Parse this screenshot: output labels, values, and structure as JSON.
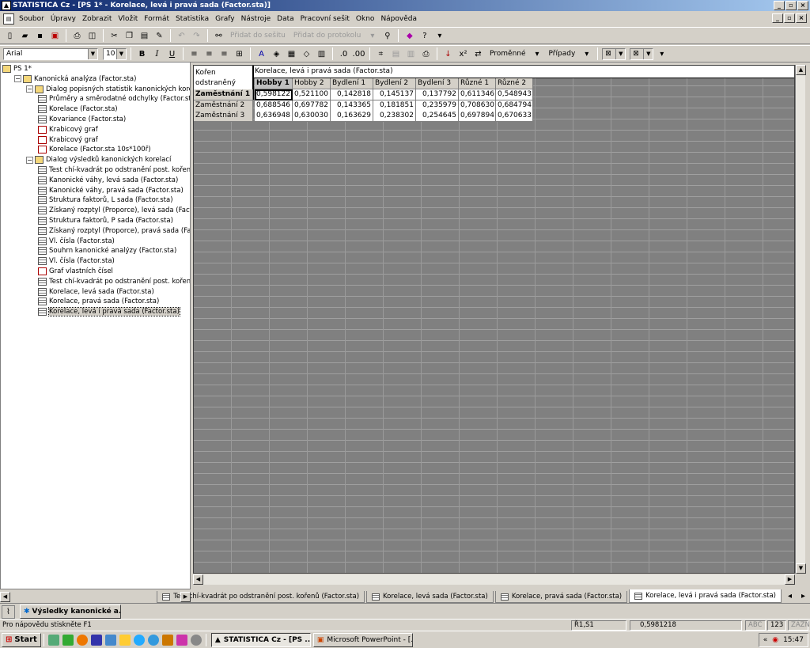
{
  "window": {
    "title": "STATISTICA Cz - [PS 1* - Korelace, levá i pravá sada (Factor.sta)]",
    "app_icon": "statistica-icon"
  },
  "menu": [
    "Soubor",
    "Úpravy",
    "Zobrazit",
    "Vložit",
    "Formát",
    "Statistika",
    "Grafy",
    "Nástroje",
    "Data",
    "Pracovní sešit",
    "Okno",
    "Nápověda"
  ],
  "toolbar1": {
    "add_to_workbook": "Přidat do sešitu",
    "add_to_report": "Přidat do protokolu"
  },
  "toolbar2": {
    "font_name": "Arial",
    "font_size": "10",
    "bold": "B",
    "italic": "I",
    "underline": "U",
    "variables": "Proměnné",
    "cases": "Případy"
  },
  "tree": [
    {
      "label": "PS 1*",
      "level": 0,
      "icon": "folder"
    },
    {
      "label": "Kanonická analýza (Factor.sta)",
      "level": 1,
      "icon": "folder",
      "exp": true
    },
    {
      "label": "Dialog popisných statistik kanonických korelací",
      "level": 2,
      "icon": "folder",
      "exp": true
    },
    {
      "label": "Průměry a směrodatné odchylky (Factor.sta)",
      "level": 3,
      "icon": "table"
    },
    {
      "label": "Korelace (Factor.sta)",
      "level": 3,
      "icon": "table"
    },
    {
      "label": "Kovariance (Factor.sta)",
      "level": 3,
      "icon": "table"
    },
    {
      "label": "Krabicový graf",
      "level": 3,
      "icon": "graph"
    },
    {
      "label": "Krabicový graf",
      "level": 3,
      "icon": "graph"
    },
    {
      "label": "Korelace (Factor.sta 10s*100ř)",
      "level": 3,
      "icon": "graph"
    },
    {
      "label": "Dialog výsledků kanonických korelací",
      "level": 2,
      "icon": "folder",
      "exp": true
    },
    {
      "label": "Test chí-kvadrát po odstranění post. kořenů (F",
      "level": 3,
      "icon": "table"
    },
    {
      "label": "Kanonické váhy, levá sada (Factor.sta)",
      "level": 3,
      "icon": "table"
    },
    {
      "label": "Kanonické váhy, pravá sada (Factor.sta)",
      "level": 3,
      "icon": "table"
    },
    {
      "label": "Struktura faktorů, L sada (Factor.sta)",
      "level": 3,
      "icon": "table"
    },
    {
      "label": "Získaný rozptyl (Proporce), levá sada (Factor.",
      "level": 3,
      "icon": "table"
    },
    {
      "label": "Struktura faktorů, P sada (Factor.sta)",
      "level": 3,
      "icon": "table"
    },
    {
      "label": "Získaný rozptyl (Proporce), pravá sada (Facto",
      "level": 3,
      "icon": "table"
    },
    {
      "label": "Vl. čísla (Factor.sta)",
      "level": 3,
      "icon": "table"
    },
    {
      "label": "Souhrn kanonické analýzy (Factor.sta)",
      "level": 3,
      "icon": "table"
    },
    {
      "label": "Vl. čísla (Factor.sta)",
      "level": 3,
      "icon": "table"
    },
    {
      "label": "Graf vlastních čísel",
      "level": 3,
      "icon": "graph"
    },
    {
      "label": "Test chí-kvadrát po odstranění post. kořenů (F",
      "level": 3,
      "icon": "table"
    },
    {
      "label": "Korelace, levá sada (Factor.sta)",
      "level": 3,
      "icon": "table"
    },
    {
      "label": "Korelace, pravá sada (Factor.sta)",
      "level": 3,
      "icon": "table"
    },
    {
      "label": "Korelace, levá i pravá sada (Factor.sta)",
      "level": 3,
      "icon": "table",
      "selected": true
    }
  ],
  "sheet": {
    "corner_line1": "Kořen",
    "corner_line2": "odstraněný",
    "title": "Korelace, levá i pravá sada (Factor.sta)",
    "columns": [
      "Hobby 1",
      "Hobby 2",
      "Bydlení 1",
      "Bydlení 2",
      "Bydlení 3",
      "Různé 1",
      "Různé 2"
    ],
    "rows": [
      {
        "label": "Zaměstnání 1",
        "values": [
          "0,598122",
          "0,521100",
          "0,142818",
          "0,145137",
          "0,137792",
          "0,611346",
          "0,548943"
        ]
      },
      {
        "label": "Zaměstnání 2",
        "values": [
          "0,688546",
          "0,697782",
          "0,143365",
          "0,181851",
          "0,235979",
          "0,708630",
          "0,684794"
        ]
      },
      {
        "label": "Zaměstnání 3",
        "values": [
          "0,636948",
          "0,630030",
          "0,163629",
          "0,238302",
          "0,254645",
          "0,697894",
          "0,670633"
        ]
      }
    ]
  },
  "tabs": [
    {
      "label": "Test chí-kvadrát po odstranění post. kořenů (Factor.sta)"
    },
    {
      "label": "Korelace, levá sada (Factor.sta)"
    },
    {
      "label": "Korelace, pravá sada (Factor.sta)"
    },
    {
      "label": "Korelace, levá i pravá sada (Factor.sta)",
      "active": true
    }
  ],
  "task_panel": {
    "label": "Výsledky kanonické a..."
  },
  "status": {
    "hint": "Pro nápovědu stiskněte F1",
    "cell": "Ř1,S1",
    "value": "0,5981218",
    "abc": "ABC",
    "num": "123",
    "mode": "ZÁZN"
  },
  "taskbar": {
    "start": "Start",
    "buttons": [
      "STATISTICA Cz - [PS ...",
      "Microsoft PowerPoint - [..."
    ],
    "clock": "15:47",
    "tray_chevron": "«"
  }
}
